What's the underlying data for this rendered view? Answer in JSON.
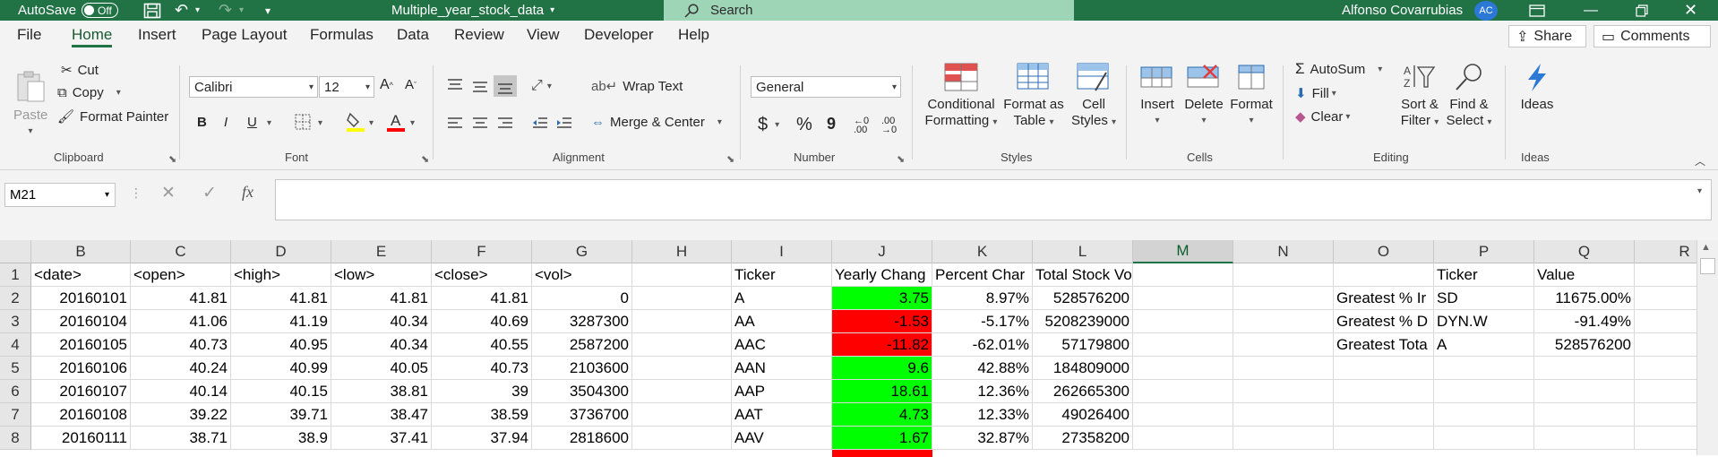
{
  "titlebar": {
    "autosave_label": "AutoSave",
    "autosave_state": "Off",
    "filename": "Multiple_year_stock_data",
    "search_placeholder": "Search",
    "user_name": "Alfonso Covarrubias",
    "user_initials": "AC"
  },
  "menu": {
    "tabs": [
      "File",
      "Home",
      "Insert",
      "Page Layout",
      "Formulas",
      "Data",
      "Review",
      "View",
      "Developer",
      "Help"
    ],
    "active": "Home",
    "share": "Share",
    "comments": "Comments"
  },
  "ribbon": {
    "clipboard": {
      "paste": "Paste",
      "cut": "Cut",
      "copy": "Copy",
      "format_painter": "Format Painter",
      "label": "Clipboard"
    },
    "font": {
      "name": "Calibri",
      "size": "12",
      "bold": "B",
      "italic": "I",
      "underline": "U",
      "label": "Font"
    },
    "alignment": {
      "wrap": "Wrap Text",
      "merge": "Merge & Center",
      "label": "Alignment"
    },
    "number": {
      "format": "General",
      "currency": "$",
      "percent": "%",
      "comma": "9",
      "label": "Number"
    },
    "styles": {
      "conditional": "Conditional",
      "conditional2": "Formatting",
      "format_table": "Format as",
      "format_table2": "Table",
      "cell_styles": "Cell",
      "cell_styles2": "Styles",
      "label": "Styles"
    },
    "cells": {
      "insert": "Insert",
      "delete": "Delete",
      "format": "Format",
      "label": "Cells"
    },
    "editing": {
      "autosum": "AutoSum",
      "fill": "Fill",
      "clear": "Clear",
      "sort": "Sort &",
      "sort2": "Filter",
      "find": "Find &",
      "find2": "Select",
      "label": "Editing"
    },
    "ideas": {
      "ideas": "Ideas",
      "label": "Ideas"
    }
  },
  "formula_bar": {
    "name_box": "M21",
    "fx": "fx",
    "value": ""
  },
  "colors": {
    "excel_green": "#217346",
    "positive": "#00ff00",
    "negative": "#ff0000"
  },
  "grid": {
    "columns": [
      "B",
      "C",
      "D",
      "E",
      "F",
      "G",
      "H",
      "I",
      "J",
      "K",
      "L",
      "M",
      "N",
      "O",
      "P",
      "Q",
      "R"
    ],
    "selected_column": "M",
    "rows": [
      "1",
      "2",
      "3",
      "4",
      "5",
      "6",
      "7",
      "8"
    ],
    "header_row": {
      "B": "<date>",
      "C": "<open>",
      "D": "<high>",
      "E": "<low>",
      "F": "<close>",
      "G": "<vol>",
      "I": "Ticker",
      "J": "Yearly Chang",
      "K": "Percent Char",
      "L": "Total Stock Volume",
      "P": "Ticker",
      "Q": "Value"
    },
    "data_rows": [
      {
        "B": "20160101",
        "C": "41.81",
        "D": "41.81",
        "E": "41.81",
        "F": "41.81",
        "G": "0",
        "I": "A",
        "J": "3.75",
        "K": "8.97%",
        "L": "528576200",
        "O": "Greatest % Ir",
        "P": "SD",
        "Q": "11675.00%"
      },
      {
        "B": "20160104",
        "C": "41.06",
        "D": "41.19",
        "E": "40.34",
        "F": "40.69",
        "G": "3287300",
        "I": "AA",
        "J": "-1.53",
        "K": "-5.17%",
        "L": "5208239000",
        "O": "Greatest % D",
        "P": "DYN.W",
        "Q": "-91.49%"
      },
      {
        "B": "20160105",
        "C": "40.73",
        "D": "40.95",
        "E": "40.34",
        "F": "40.55",
        "G": "2587200",
        "I": "AAC",
        "J": "-11.82",
        "K": "-62.01%",
        "L": "57179800",
        "O": "Greatest Tota",
        "P": "A",
        "Q": "528576200"
      },
      {
        "B": "20160106",
        "C": "40.24",
        "D": "40.99",
        "E": "40.05",
        "F": "40.73",
        "G": "2103600",
        "I": "AAN",
        "J": "9.6",
        "K": "42.88%",
        "L": "184809000"
      },
      {
        "B": "20160107",
        "C": "40.14",
        "D": "40.15",
        "E": "38.81",
        "F": "39",
        "G": "3504300",
        "I": "AAP",
        "J": "18.61",
        "K": "12.36%",
        "L": "262665300"
      },
      {
        "B": "20160108",
        "C": "39.22",
        "D": "39.71",
        "E": "38.47",
        "F": "38.59",
        "G": "3736700",
        "I": "AAT",
        "J": "4.73",
        "K": "12.33%",
        "L": "49026400"
      },
      {
        "B": "20160111",
        "C": "38.71",
        "D": "38.9",
        "E": "37.41",
        "F": "37.94",
        "G": "2818600",
        "I": "AAV",
        "J": "1.67",
        "K": "32.87%",
        "L": "27358200"
      }
    ]
  }
}
